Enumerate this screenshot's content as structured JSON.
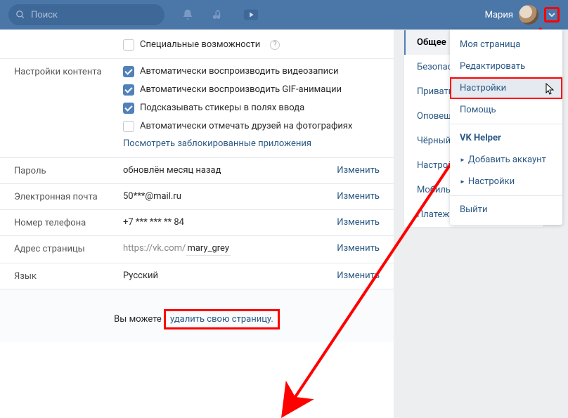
{
  "header": {
    "search_placeholder": "Поиск",
    "username": "Мария"
  },
  "sections": {
    "accessibility": {
      "label": "",
      "special": "Специальные возможности"
    },
    "content": {
      "label": "Настройки контента",
      "autoplay_video": "Автоматически воспроизводить видеозаписи",
      "autoplay_gif": "Автоматически воспроизводить GIF-анимации",
      "suggest_stickers": "Подсказывать стикеры в полях ввода",
      "auto_tag": "Автоматически отмечать друзей на фотографиях",
      "blocked_apps": "Посмотреть заблокированные приложения"
    },
    "password": {
      "label": "Пароль",
      "value": "обновлён месяц назад",
      "action": "Изменить"
    },
    "email": {
      "label": "Электронная почта",
      "value": "50***@mail.ru",
      "action": "Изменить"
    },
    "phone": {
      "label": "Номер телефона",
      "value": "+7 *** *** ** 84",
      "action": "Изменить"
    },
    "address": {
      "label": "Адрес страницы",
      "prefix": "https://vk.com/",
      "slug": "mary_grey",
      "action": "Изменить"
    },
    "language": {
      "label": "Язык",
      "value": "Русский",
      "action": "Изменить"
    }
  },
  "footer": {
    "prefix": "Вы можете ",
    "link": "удалить свою страницу."
  },
  "settings_nav": [
    "Общее",
    "Безопасность",
    "Приватность",
    "Оповещения",
    "Чёрный список",
    "Настройки VK Pay",
    "Мобильные сервисы",
    "Платежи и подписки"
  ],
  "user_menu": {
    "my_page": "Моя страница",
    "edit": "Редактировать",
    "settings": "Настройки",
    "help": "Помощь",
    "vkhelper": "VK Helper",
    "add_account": "Добавить аккаунт",
    "helper_settings": "Настройки",
    "logout": "Выйти"
  }
}
